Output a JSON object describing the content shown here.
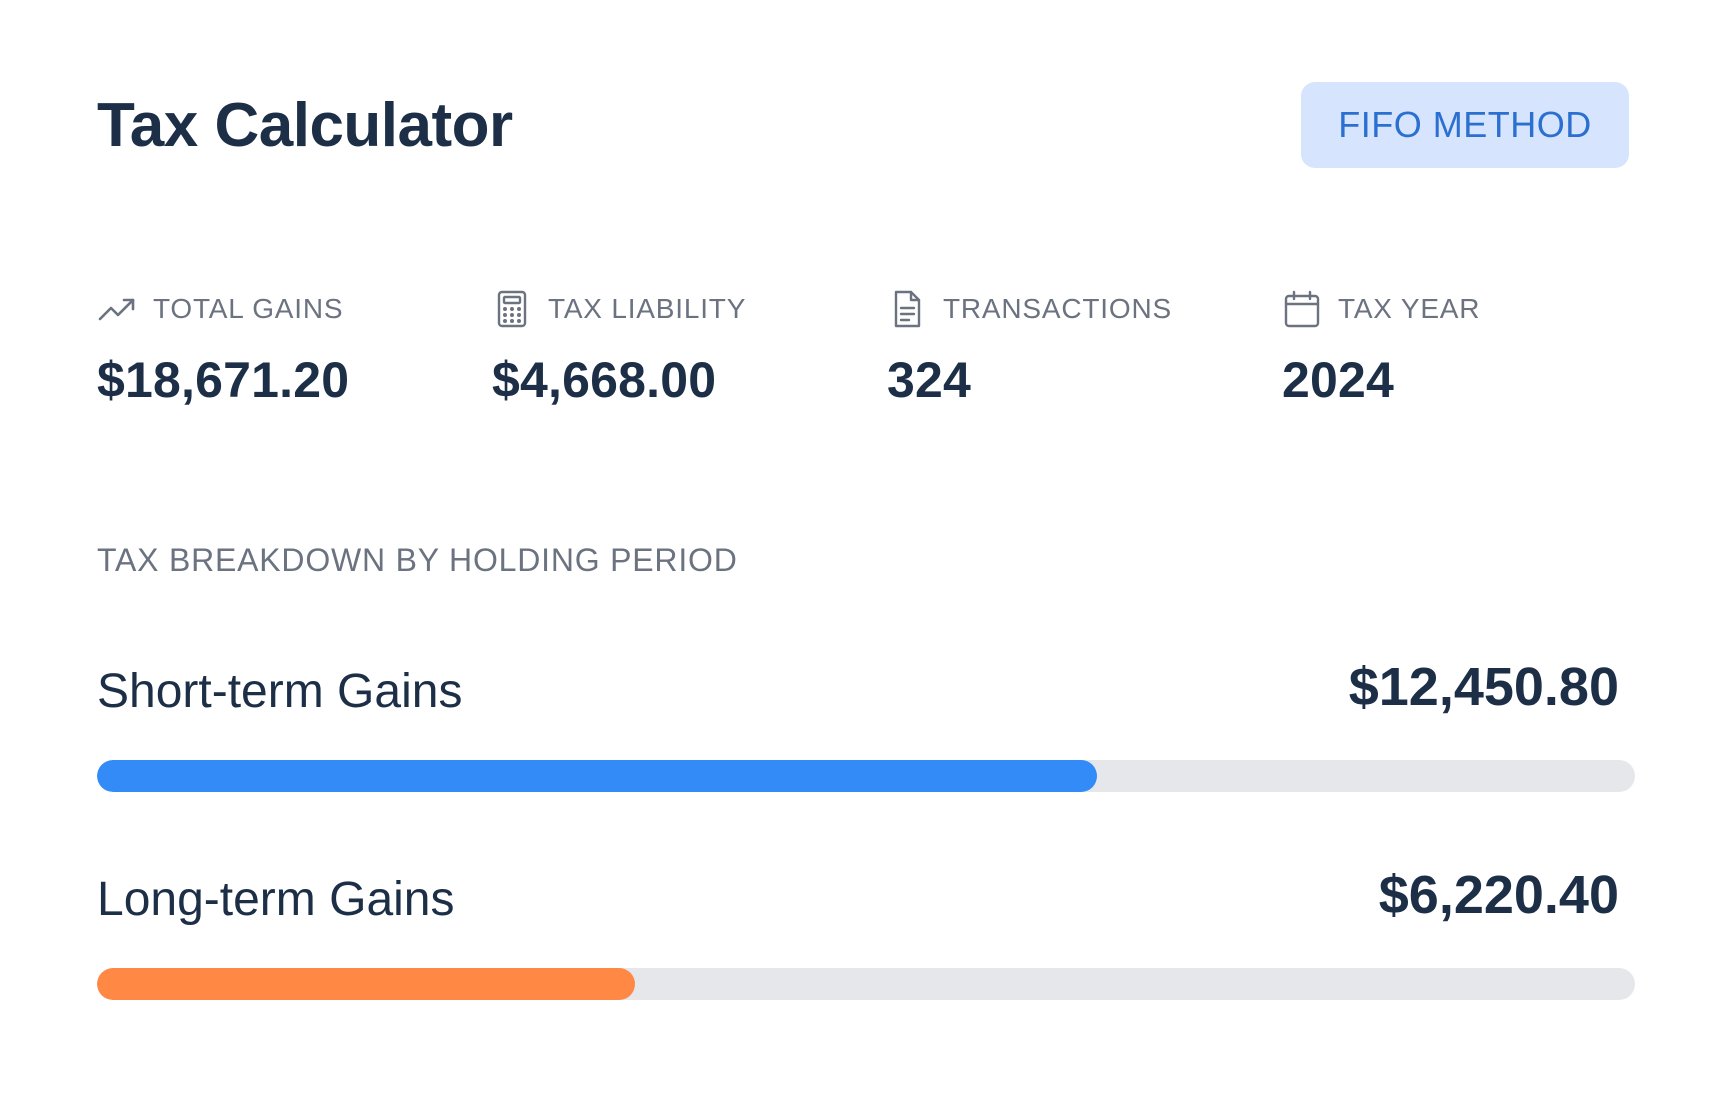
{
  "header": {
    "title": "Tax Calculator",
    "method_badge": "FIFO METHOD"
  },
  "stats": [
    {
      "icon": "trending-up-icon",
      "label": "TOTAL GAINS",
      "value": "$18,671.20"
    },
    {
      "icon": "calculator-icon",
      "label": "TAX LIABILITY",
      "value": "$4,668.00"
    },
    {
      "icon": "document-icon",
      "label": "TRANSACTIONS",
      "value": "324"
    },
    {
      "icon": "calendar-icon",
      "label": "TAX YEAR",
      "value": "2024"
    }
  ],
  "breakdown": {
    "title": "TAX BREAKDOWN BY HOLDING PERIOD",
    "rows": [
      {
        "label": "Short-term Gains",
        "amount": "$12,450.80",
        "fraction": 0.65,
        "color": "#338bf7"
      },
      {
        "label": "Long-term Gains",
        "amount": "$6,220.40",
        "fraction": 0.35,
        "color": "#ff8844"
      }
    ]
  },
  "colors": {
    "text_primary": "#1c2f47",
    "text_muted": "#6b7280",
    "badge_bg": "#d6e5fd",
    "badge_text": "#2b6fd0",
    "track": "#e5e7eb"
  }
}
